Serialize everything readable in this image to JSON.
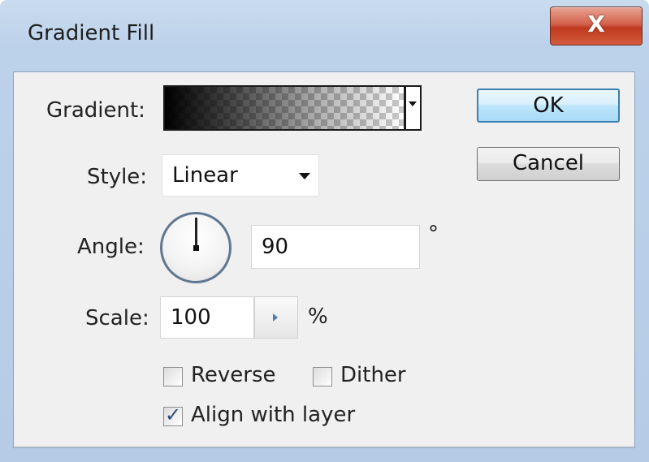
{
  "window": {
    "title": "Gradient Fill",
    "close_glyph": "X"
  },
  "gradient": {
    "label": "Gradient:"
  },
  "style": {
    "label": "Style:",
    "value": "Linear"
  },
  "angle": {
    "label": "Angle:",
    "value": "90",
    "unit": "°"
  },
  "scale": {
    "label": "Scale:",
    "value": "100",
    "unit": "%"
  },
  "options": {
    "reverse": {
      "label": "Reverse",
      "checked": false
    },
    "dither": {
      "label": "Dither",
      "checked": false
    },
    "align": {
      "label": "Align with layer",
      "checked": true
    }
  },
  "buttons": {
    "ok": "OK",
    "cancel": "Cancel"
  },
  "colors": {
    "ok_border": "#3c7fb1",
    "close_red": "#c0391f",
    "frame_blue": "#bcd1ea"
  }
}
